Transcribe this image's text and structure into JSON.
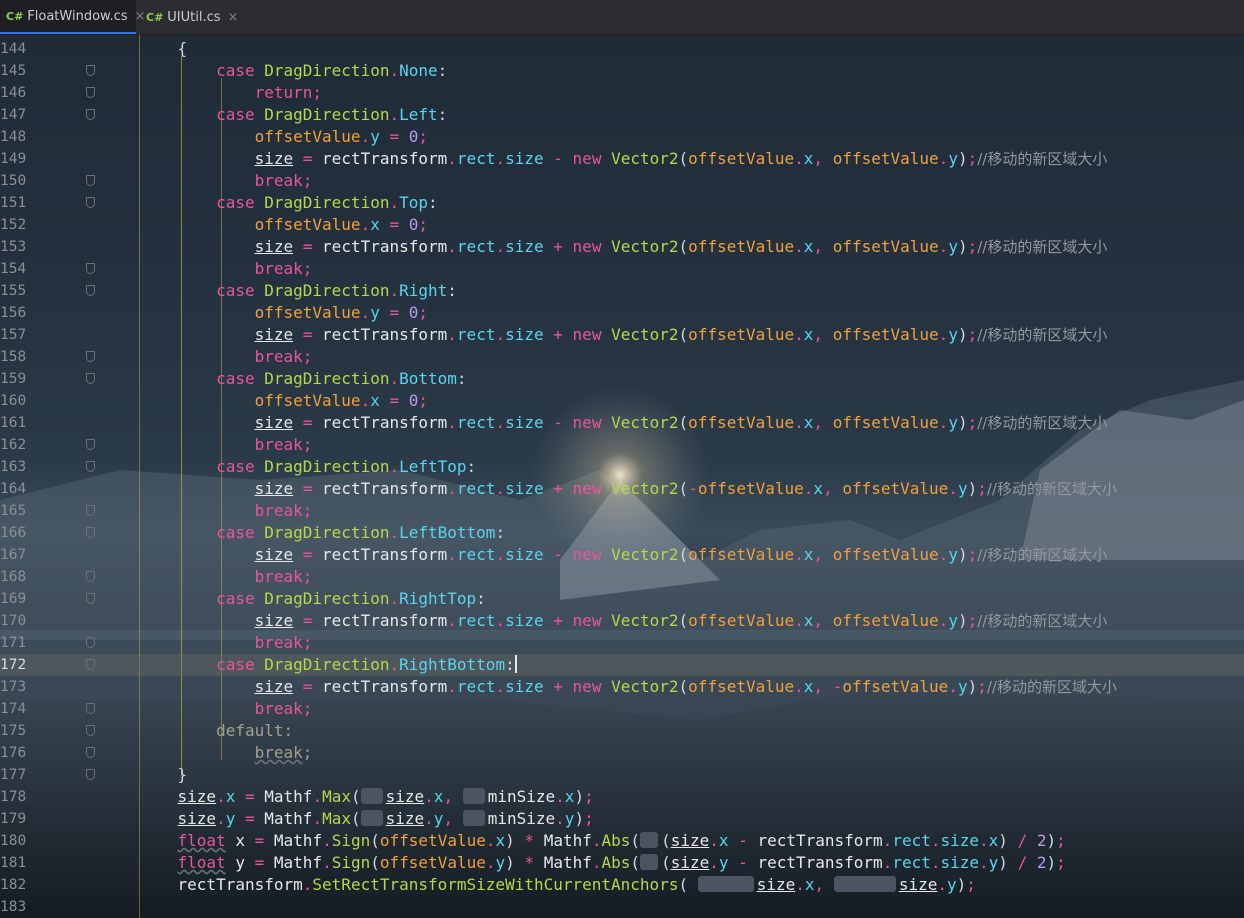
{
  "tabs": [
    {
      "lang": "C#",
      "label": "FloatWindow.cs",
      "active": true
    },
    {
      "lang": "C#",
      "label": "UIUtil.cs",
      "active": false
    }
  ],
  "tab_close_glyph": "×",
  "current_line": 172,
  "line_numbers": [
    "144",
    "145",
    "146",
    "147",
    "148",
    "149",
    "150",
    "151",
    "152",
    "153",
    "154",
    "155",
    "156",
    "157",
    "158",
    "159",
    "160",
    "161",
    "162",
    "163",
    "164",
    "165",
    "166",
    "167",
    "168",
    "169",
    "170",
    "171",
    "172",
    "173",
    "174",
    "175",
    "176",
    "177",
    "178",
    "179",
    "180",
    "181",
    "182",
    "183"
  ],
  "code": {
    "brace_open": "{",
    "brace_close": "}",
    "case_kw": "case",
    "return_kw": "return",
    "break_kw": "break",
    "default_kw": "default",
    "new_kw": "new",
    "float_kw": "float",
    "enum_type": "DragDirection",
    "enum_members": [
      "None",
      "Left",
      "Top",
      "Right",
      "Bottom",
      "LeftTop",
      "LeftBottom",
      "RightTop",
      "RightBottom"
    ],
    "offset_var": "offsetValue",
    "size_var": "size",
    "rect_transform": "rectTransform",
    "rect_prop": "rect",
    "vector_type": "Vector2",
    "mathf": "Mathf",
    "max_fn": "Max",
    "sign_fn": "Sign",
    "abs_fn": "Abs",
    "min_size": "minSize",
    "set_anchors_fn": "SetRectTransformSizeWithCurrentAnchors",
    "x": "x",
    "y": "y",
    "zero": "0",
    "two": "2",
    "comment": "//移动的新区域大小"
  }
}
